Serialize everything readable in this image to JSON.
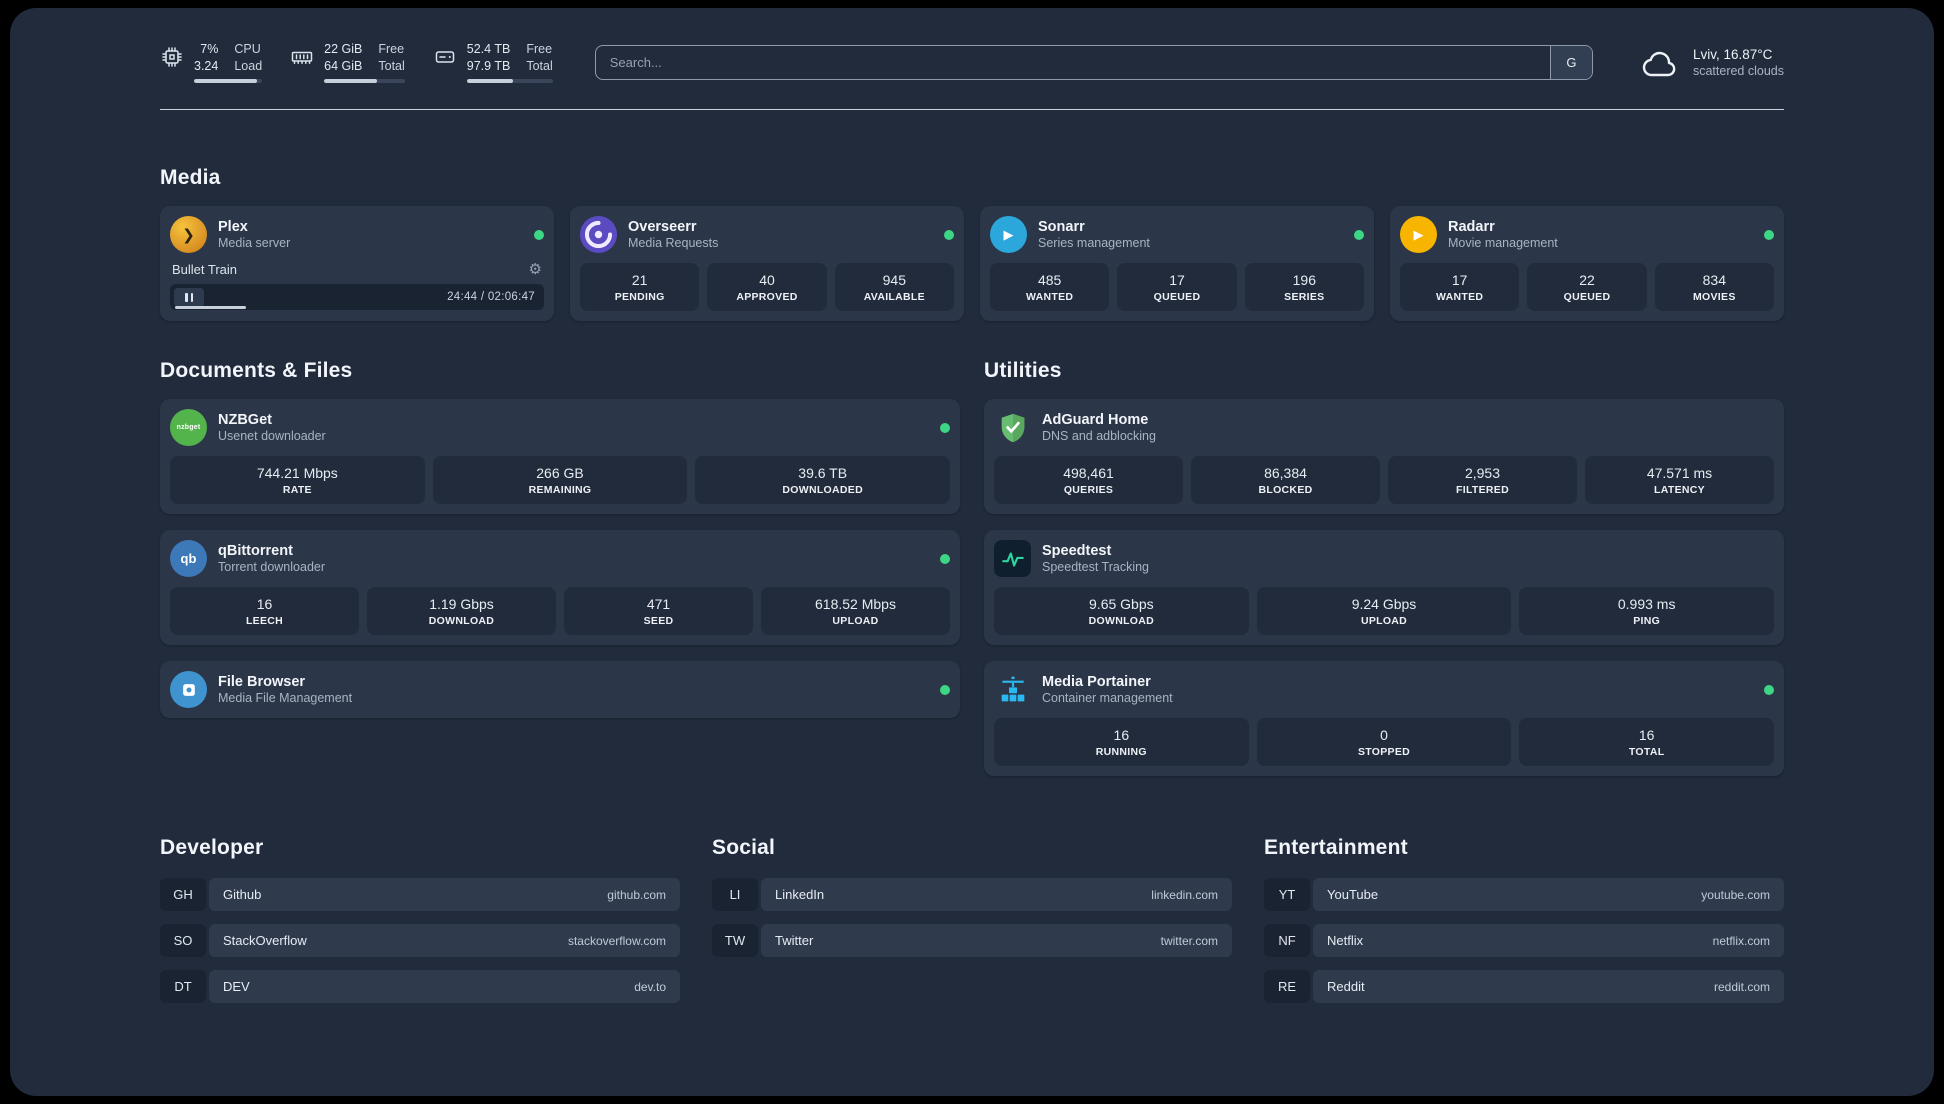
{
  "topbar": {
    "metrics": [
      {
        "value1": "7%",
        "label1": "CPU",
        "value2": "3.24",
        "label2": "Load",
        "fill": 93
      },
      {
        "value1": "22 GiB",
        "label1": "Free",
        "value2": "64 GiB",
        "label2": "Total",
        "fill": 66
      },
      {
        "value1": "52.4 TB",
        "label1": "Free",
        "value2": "97.9 TB",
        "label2": "Total",
        "fill": 54
      }
    ],
    "search": {
      "placeholder": "Search...",
      "provider_button": "G"
    },
    "weather": {
      "location": "Lviv, 16.87°C",
      "condition": "scattered clouds"
    }
  },
  "media": {
    "title": "Media",
    "cards": [
      {
        "name": "Plex",
        "subtitle": "Media server",
        "online": true,
        "player": {
          "track": "Bullet Train",
          "time": "24:44 / 02:06:47",
          "progress": 19
        }
      },
      {
        "name": "Overseerr",
        "subtitle": "Media Requests",
        "online": true,
        "stats": [
          {
            "value": "21",
            "label": "PENDING"
          },
          {
            "value": "40",
            "label": "APPROVED"
          },
          {
            "value": "945",
            "label": "AVAILABLE"
          }
        ]
      },
      {
        "name": "Sonarr",
        "subtitle": "Series management",
        "online": true,
        "stats": [
          {
            "value": "485",
            "label": "WANTED"
          },
          {
            "value": "17",
            "label": "QUEUED"
          },
          {
            "value": "196",
            "label": "SERIES"
          }
        ]
      },
      {
        "name": "Radarr",
        "subtitle": "Movie management",
        "online": true,
        "stats": [
          {
            "value": "17",
            "label": "WANTED"
          },
          {
            "value": "22",
            "label": "QUEUED"
          },
          {
            "value": "834",
            "label": "MOVIES"
          }
        ]
      }
    ]
  },
  "documents": {
    "title": "Documents & Files",
    "cards": [
      {
        "name": "NZBGet",
        "subtitle": "Usenet downloader",
        "online": true,
        "stats": [
          {
            "value": "744.21 Mbps",
            "label": "RATE"
          },
          {
            "value": "266 GB",
            "label": "REMAINING"
          },
          {
            "value": "39.6 TB",
            "label": "DOWNLOADED"
          }
        ]
      },
      {
        "name": "qBittorrent",
        "subtitle": "Torrent downloader",
        "online": true,
        "stats": [
          {
            "value": "16",
            "label": "LEECH"
          },
          {
            "value": "1.19 Gbps",
            "label": "DOWNLOAD"
          },
          {
            "value": "471",
            "label": "SEED"
          },
          {
            "value": "618.52 Mbps",
            "label": "UPLOAD"
          }
        ]
      },
      {
        "name": "File Browser",
        "subtitle": "Media File Management",
        "online": true
      }
    ]
  },
  "utilities": {
    "title": "Utilities",
    "cards": [
      {
        "name": "AdGuard Home",
        "subtitle": "DNS and adblocking",
        "stats": [
          {
            "value": "498,461",
            "label": "QUERIES"
          },
          {
            "value": "86,384",
            "label": "BLOCKED"
          },
          {
            "value": "2,953",
            "label": "FILTERED"
          },
          {
            "value": "47.571 ms",
            "label": "LATENCY"
          }
        ]
      },
      {
        "name": "Speedtest",
        "subtitle": "Speedtest Tracking",
        "stats": [
          {
            "value": "9.65 Gbps",
            "label": "DOWNLOAD"
          },
          {
            "value": "9.24 Gbps",
            "label": "UPLOAD"
          },
          {
            "value": "0.993 ms",
            "label": "PING"
          }
        ]
      },
      {
        "name": "Media Portainer",
        "subtitle": "Container management",
        "online": true,
        "stats": [
          {
            "value": "16",
            "label": "RUNNING"
          },
          {
            "value": "0",
            "label": "STOPPED"
          },
          {
            "value": "16",
            "label": "TOTAL"
          }
        ]
      }
    ]
  },
  "bookmarks": {
    "groups": [
      {
        "title": "Developer",
        "items": [
          {
            "abbr": "GH",
            "name": "Github",
            "url": "github.com"
          },
          {
            "abbr": "SO",
            "name": "StackOverflow",
            "url": "stackoverflow.com"
          },
          {
            "abbr": "DT",
            "name": "DEV",
            "url": "dev.to"
          }
        ]
      },
      {
        "title": "Social",
        "items": [
          {
            "abbr": "LI",
            "name": "LinkedIn",
            "url": "linkedin.com"
          },
          {
            "abbr": "TW",
            "name": "Twitter",
            "url": "twitter.com"
          }
        ]
      },
      {
        "title": "Entertainment",
        "items": [
          {
            "abbr": "YT",
            "name": "YouTube",
            "url": "youtube.com"
          },
          {
            "abbr": "NF",
            "name": "Netflix",
            "url": "netflix.com"
          },
          {
            "abbr": "RE",
            "name": "Reddit",
            "url": "reddit.com"
          }
        ]
      }
    ]
  },
  "icons": {
    "nzbget_text": "nzbget",
    "qbittorrent_text": "qb"
  },
  "colors": {
    "status_online": "#3dd684",
    "page_bg": "#212b3c",
    "card_bg": "#2b3648"
  }
}
